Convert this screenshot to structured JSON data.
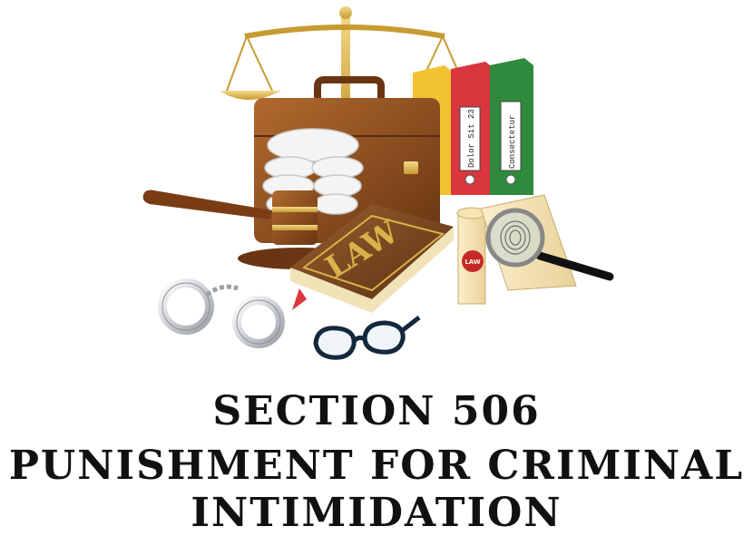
{
  "illustration": {
    "law_book_text": "LAW",
    "binder_red_label": "Dolor Sit 23",
    "binder_green_label": "Consectetur",
    "seal_text": "LAW"
  },
  "heading": {
    "line1": "SECTION 506",
    "line2": "PUNISHMENT FOR CRIMINAL",
    "line3": "INTIMIDATION"
  },
  "colors": {
    "gold": "#d8b24a",
    "leather": "#8a4a1c",
    "book": "#7a4a22",
    "binder_yellow": "#f1c232",
    "binder_red": "#d9363e",
    "binder_green": "#2f8a3e",
    "text": "#111111"
  }
}
